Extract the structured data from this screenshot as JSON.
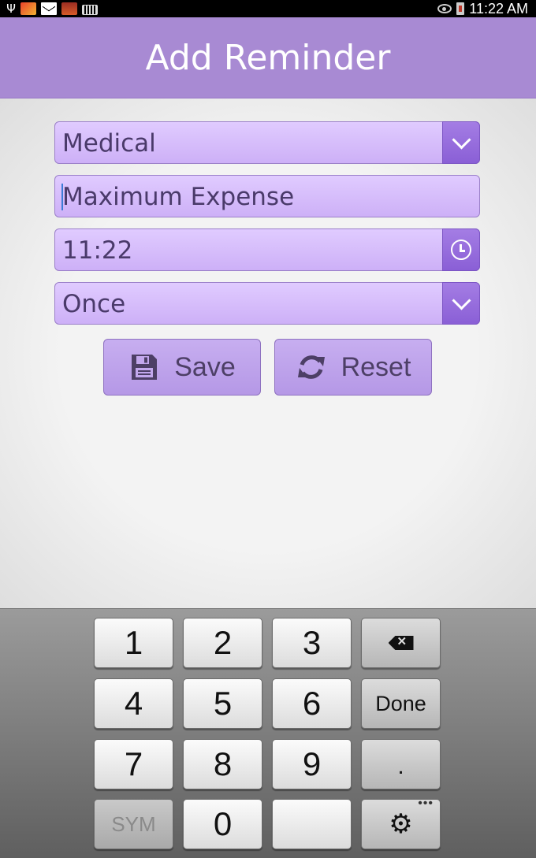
{
  "status_bar": {
    "time": "11:22 AM",
    "left_icons": [
      "usb-icon",
      "app-notification-icon",
      "gmail-icon",
      "app-notification-icon",
      "keyboard-icon"
    ],
    "right_icons": [
      "eye-icon",
      "battery-icon"
    ]
  },
  "header": {
    "title": "Add Reminder"
  },
  "form": {
    "category": {
      "value": "Medical",
      "icon": "chevron-down-icon"
    },
    "name": {
      "value": "Maximum Expense"
    },
    "time": {
      "value": "11:22",
      "icon": "clock-icon"
    },
    "repeat": {
      "value": "Once",
      "icon": "chevron-down-icon"
    }
  },
  "buttons": {
    "save": {
      "label": "Save",
      "icon": "floppy-disk-icon"
    },
    "reset": {
      "label": "Reset",
      "icon": "refresh-icon"
    }
  },
  "keyboard": {
    "rows": [
      [
        "1",
        "2",
        "3",
        "backspace"
      ],
      [
        "4",
        "5",
        "6",
        "Done"
      ],
      [
        "7",
        "8",
        "9",
        "."
      ],
      [
        "SYM",
        "0",
        "",
        "settings"
      ]
    ],
    "done_label": "Done",
    "sym_label": "SYM",
    "dot_label": "."
  }
}
